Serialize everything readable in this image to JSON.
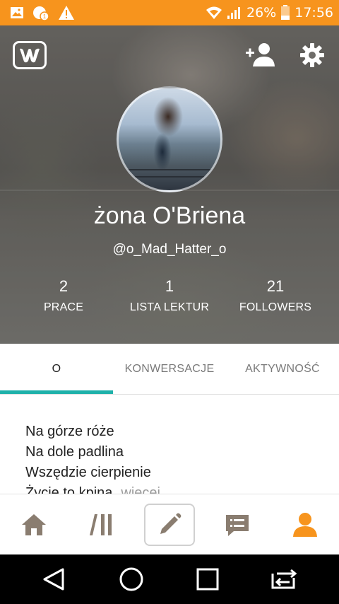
{
  "status_bar": {
    "battery_percent": "26%",
    "time": "17:56",
    "icons": [
      "image-icon",
      "notification-badge-icon",
      "warning-icon",
      "wifi-icon",
      "signal-icon",
      "battery-icon"
    ],
    "background": "#f7941d"
  },
  "header": {
    "logo_icon": "wattpad-logo-icon",
    "add_friend_icon": "add-person-icon",
    "settings_icon": "gear-icon"
  },
  "profile": {
    "name": "żona O'Briena",
    "handle": "@o_Mad_Hatter_o",
    "stats": [
      {
        "value": "2",
        "label": "PRACE"
      },
      {
        "value": "1",
        "label": "LISTA LEKTUR"
      },
      {
        "value": "21",
        "label": "FOLLOWERS"
      }
    ]
  },
  "tabs": [
    {
      "label": "O",
      "active": true
    },
    {
      "label": "KONWERSACJE",
      "active": false
    },
    {
      "label": "AKTYWNOŚĆ",
      "active": false
    }
  ],
  "accent_color": "#1fb1aa",
  "bio": {
    "lines": [
      "Na górze róże",
      "Na dole padlina",
      "Wszędzie cierpienie",
      "Życie to kpina"
    ],
    "more_label": "więcej"
  },
  "bottom_nav": {
    "items": [
      "home-icon",
      "library-icon",
      "write-icon",
      "messages-icon",
      "profile-icon"
    ],
    "active_color": "#f7941d",
    "inactive_color": "#8a7d70"
  },
  "system_nav": {
    "items": [
      "back-icon",
      "home-circle-icon",
      "recents-icon",
      "switch-app-icon"
    ]
  }
}
